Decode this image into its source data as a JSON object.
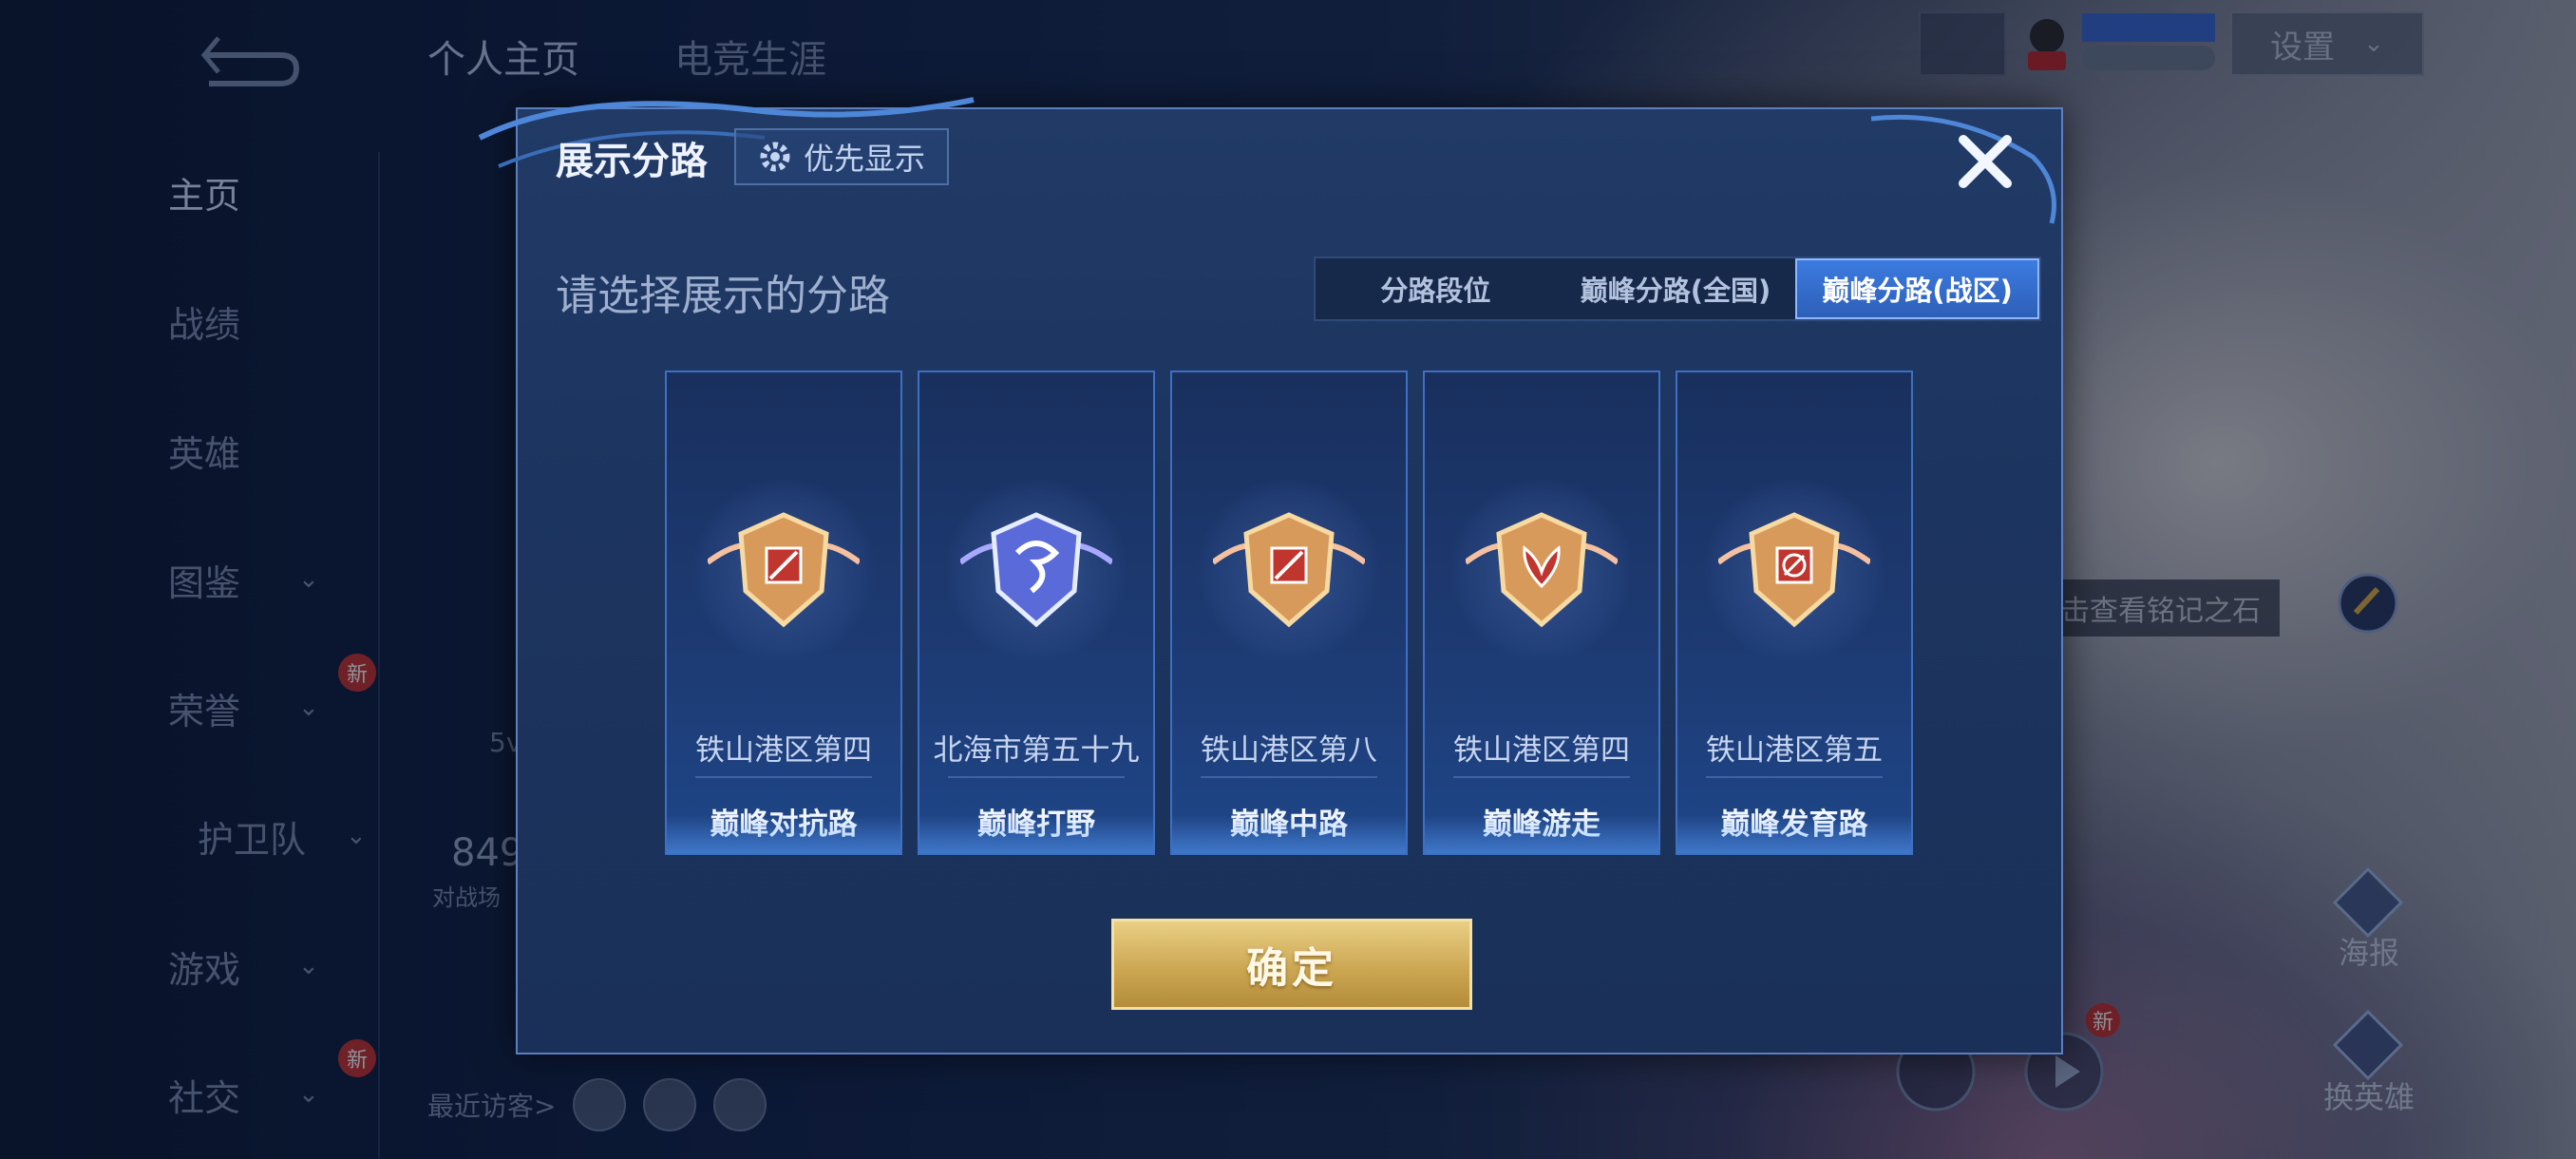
{
  "header": {
    "tabs": [
      {
        "label": "个人主页",
        "active": true
      },
      {
        "label": "电竞生涯",
        "active": false
      }
    ],
    "settings_label": "设置"
  },
  "sidebar": {
    "items": [
      {
        "label": "主页",
        "active": true,
        "has_chevron": false,
        "new": false
      },
      {
        "label": "战绩",
        "active": false,
        "has_chevron": false,
        "new": false
      },
      {
        "label": "英雄",
        "active": false,
        "has_chevron": false,
        "new": false
      },
      {
        "label": "图鉴",
        "active": false,
        "has_chevron": true,
        "new": false
      },
      {
        "label": "荣誉",
        "active": false,
        "has_chevron": true,
        "new": true
      },
      {
        "label": "护卫队",
        "active": false,
        "has_chevron": true,
        "new": false
      },
      {
        "label": "游戏",
        "active": false,
        "has_chevron": true,
        "new": false
      },
      {
        "label": "社交",
        "active": false,
        "has_chevron": true,
        "new": true
      }
    ],
    "new_badge": "新"
  },
  "profile": {
    "mode_text": "5v",
    "stat_value": "849",
    "stat_label": "对战场",
    "recent_visitors_label": "最近访客>"
  },
  "right_panel": {
    "inscription_label": "点击查看铭记之石",
    "poster_label": "海报",
    "change_hero_label": "换英雄",
    "new_badge": "新"
  },
  "modal": {
    "title": "展示分路",
    "priority_label": "优先显示",
    "subtitle": "请选择展示的分路",
    "segments": [
      {
        "label": "分路段位",
        "selected": false
      },
      {
        "label": "巅峰分路(全国)",
        "selected": false
      },
      {
        "label": "巅峰分路(战区)",
        "selected": true
      }
    ],
    "cards": [
      {
        "region": "铁山港区第四",
        "lane": "巅峰对抗路",
        "badge": "gold-shield-icon"
      },
      {
        "region": "北海市第五十九",
        "lane": "巅峰打野",
        "badge": "silver-dragon-shield-icon"
      },
      {
        "region": "铁山港区第八",
        "lane": "巅峰中路",
        "badge": "gold-shield-icon"
      },
      {
        "region": "铁山港区第四",
        "lane": "巅峰游走",
        "badge": "gold-wing-shield-icon"
      },
      {
        "region": "铁山港区第五",
        "lane": "巅峰发育路",
        "badge": "gold-target-shield-icon"
      }
    ],
    "confirm_label": "确定"
  },
  "colors": {
    "accent_blue": "#2d5fb8",
    "confirm_gold": "#caa44f",
    "badge_red": "#c9332e"
  }
}
